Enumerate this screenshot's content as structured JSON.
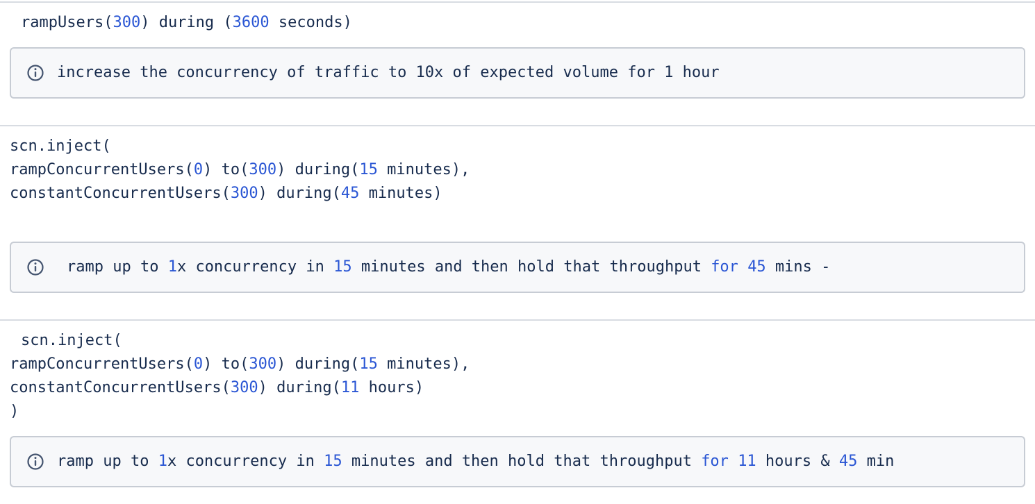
{
  "colors": {
    "text": "#172b4d",
    "number": "#2a56d4",
    "panel_border": "#c7ccd4",
    "panel_bg": "#f7f8fa",
    "rule": "#d8dce2"
  },
  "block1": {
    "code_line1": [
      {
        "t": "rampUsers(",
        "k": "text"
      },
      {
        "t": "300",
        "k": "num"
      },
      {
        "t": ") during (",
        "k": "text"
      },
      {
        "t": "3600",
        "k": "num"
      },
      {
        "t": " seconds)",
        "k": "text"
      }
    ],
    "info_icon": "info-circle-icon",
    "note": [
      {
        "t": "increase the concurrency of traffic to 10x of expected volume for 1 hour",
        "k": "text"
      }
    ]
  },
  "block2": {
    "code_line1": [
      {
        "t": "scn.inject(",
        "k": "text"
      }
    ],
    "code_line2": [
      {
        "t": "rampConcurrentUsers(",
        "k": "text"
      },
      {
        "t": "0",
        "k": "num"
      },
      {
        "t": ") to(",
        "k": "text"
      },
      {
        "t": "300",
        "k": "num"
      },
      {
        "t": ") during(",
        "k": "text"
      },
      {
        "t": "15",
        "k": "num"
      },
      {
        "t": " minutes),",
        "k": "text"
      }
    ],
    "code_line3": [
      {
        "t": "constantConcurrentUsers(",
        "k": "text"
      },
      {
        "t": "300",
        "k": "num"
      },
      {
        "t": ") during(",
        "k": "text"
      },
      {
        "t": "45",
        "k": "num"
      },
      {
        "t": " minutes)",
        "k": "text"
      }
    ],
    "info_icon": "info-circle-icon",
    "note": [
      {
        "t": "ramp up to ",
        "k": "text"
      },
      {
        "t": "1",
        "k": "num"
      },
      {
        "t": "x concurrency in ",
        "k": "text"
      },
      {
        "t": "15",
        "k": "num"
      },
      {
        "t": " minutes and then hold that throughput ",
        "k": "text"
      },
      {
        "t": "for",
        "k": "kw"
      },
      {
        "t": " ",
        "k": "text"
      },
      {
        "t": "45",
        "k": "num"
      },
      {
        "t": " mins -",
        "k": "text"
      }
    ]
  },
  "block3": {
    "code_line1": [
      {
        "t": "scn.inject(",
        "k": "text"
      }
    ],
    "code_line2": [
      {
        "t": "rampConcurrentUsers(",
        "k": "text"
      },
      {
        "t": "0",
        "k": "num"
      },
      {
        "t": ") to(",
        "k": "text"
      },
      {
        "t": "300",
        "k": "num"
      },
      {
        "t": ") during(",
        "k": "text"
      },
      {
        "t": "15",
        "k": "num"
      },
      {
        "t": " minutes),",
        "k": "text"
      }
    ],
    "code_line3": [
      {
        "t": "constantConcurrentUsers(",
        "k": "text"
      },
      {
        "t": "300",
        "k": "num"
      },
      {
        "t": ") during(",
        "k": "text"
      },
      {
        "t": "11",
        "k": "num"
      },
      {
        "t": " hours)",
        "k": "text"
      }
    ],
    "code_line4": [
      {
        "t": ")",
        "k": "text"
      }
    ],
    "info_icon": "info-circle-icon",
    "note": [
      {
        "t": "ramp up to ",
        "k": "text"
      },
      {
        "t": "1",
        "k": "num"
      },
      {
        "t": "x concurrency in ",
        "k": "text"
      },
      {
        "t": "15",
        "k": "num"
      },
      {
        "t": " minutes and then hold that throughput ",
        "k": "text"
      },
      {
        "t": "for",
        "k": "kw"
      },
      {
        "t": " ",
        "k": "text"
      },
      {
        "t": "11",
        "k": "num"
      },
      {
        "t": " hours & ",
        "k": "text"
      },
      {
        "t": "45",
        "k": "num"
      },
      {
        "t": " min",
        "k": "text"
      }
    ]
  }
}
